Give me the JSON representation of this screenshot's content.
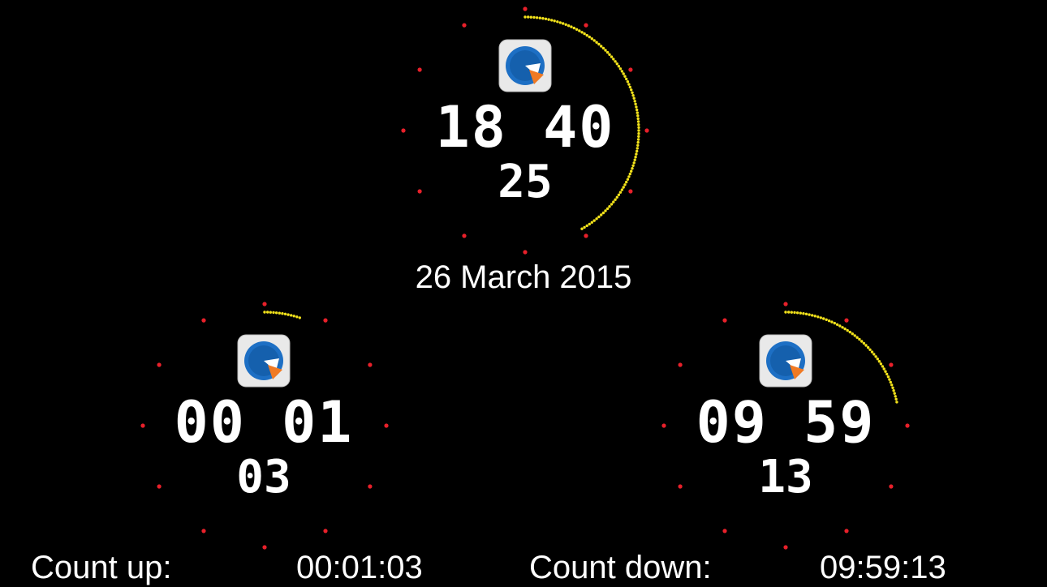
{
  "colors": {
    "background": "#000000",
    "text": "#ffffff",
    "hour_marker": "#e8202a",
    "seconds_arc": "#f2e21b",
    "icon_blue": "#1d6fc4",
    "icon_orange": "#f07a24"
  },
  "icons": {
    "app_icon": "clock-app-icon"
  },
  "clock_main": {
    "hours_minutes": "18 40",
    "seconds": "25",
    "seconds_progress": 0.4167
  },
  "date": "26 March 2015",
  "count_up": {
    "hours_minutes": "00 01",
    "seconds": "03",
    "seconds_progress": 0.05,
    "label": "Count up:",
    "value": "00:01:03"
  },
  "count_down": {
    "hours_minutes": "09 59",
    "seconds": "13",
    "seconds_progress": 0.2167,
    "label": "Count down:",
    "value": "09:59:13"
  }
}
